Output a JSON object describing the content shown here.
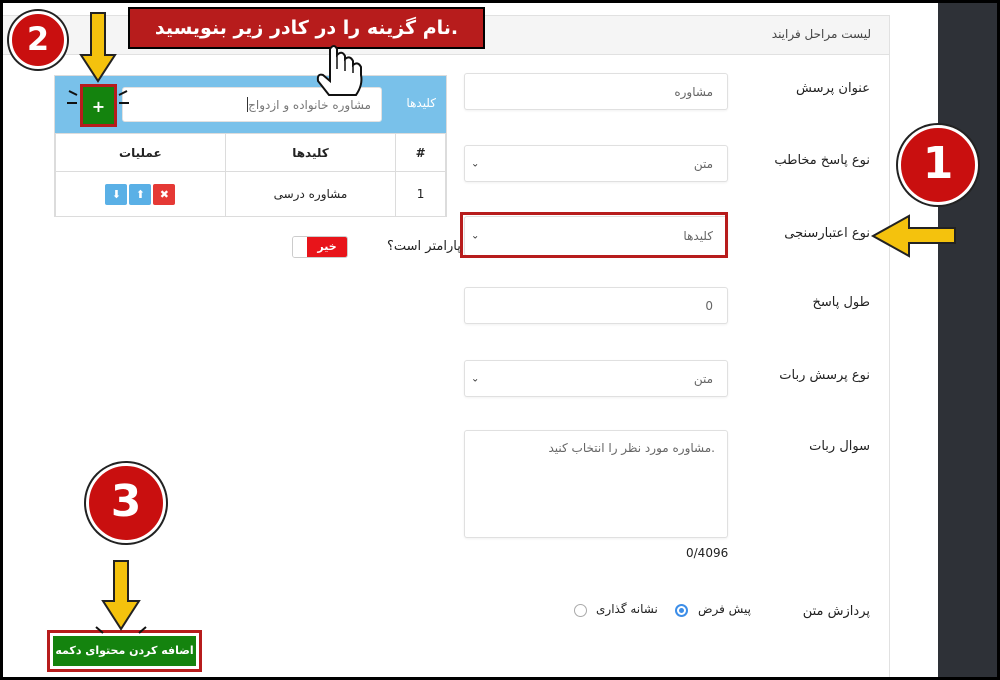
{
  "panel": {
    "title": "لیست مراحل فرایند"
  },
  "form": {
    "question_title": {
      "label": "عنوان پرسش",
      "value": "مشاوره"
    },
    "response_type": {
      "label": "نوع پاسخ مخاطب",
      "value": "متن"
    },
    "validation_type": {
      "label": "نوع اعتبارسنجی",
      "value": "کلیدها"
    },
    "response_length": {
      "label": "طول پاسخ",
      "value": "0"
    },
    "bot_question_type": {
      "label": "نوع پرسش ربات",
      "value": "متن"
    },
    "bot_question": {
      "label": "سوال ربات",
      "value": "مشاوره مورد نظر را انتخاب کنید.",
      "counter": "0/4096"
    },
    "text_processing": {
      "label": "پردازش متن",
      "options": [
        "پیش فرض",
        "نشانه گذاری"
      ],
      "selected": "پیش فرض"
    }
  },
  "keywords": {
    "title": "کلیدها",
    "input_placeholder": "مشاوره خانواده و ازدواج",
    "add_label": "+",
    "columns": [
      "#",
      "کلیدها",
      "عملیات"
    ],
    "rows": [
      {
        "index": "1",
        "keyword": "مشاوره درسی"
      }
    ],
    "actions": {
      "delete": "✖",
      "up": "⬆",
      "down": "⬇"
    }
  },
  "parameter": {
    "label": "پارامتر است؟",
    "toggle_value": "خیر"
  },
  "submit_label": "اضافه کردن محتوای دکمه",
  "annotations": {
    "banner": "نام گزینه را در کادر زیر بنویسید.",
    "step1": "1",
    "step2": "2",
    "step3": "3"
  },
  "colors": {
    "accent_red": "#b71c1c",
    "green": "#14830e",
    "keywords_header": "#79c1ea",
    "arrow_yellow": "#f4c20d",
    "sidebar_dark": "#2e3137"
  },
  "icons": [
    "plus-icon",
    "delete-icon",
    "arrow-up-icon",
    "arrow-down-icon",
    "chevron-down-icon",
    "hand-pointer-icon",
    "arrow-icon"
  ]
}
